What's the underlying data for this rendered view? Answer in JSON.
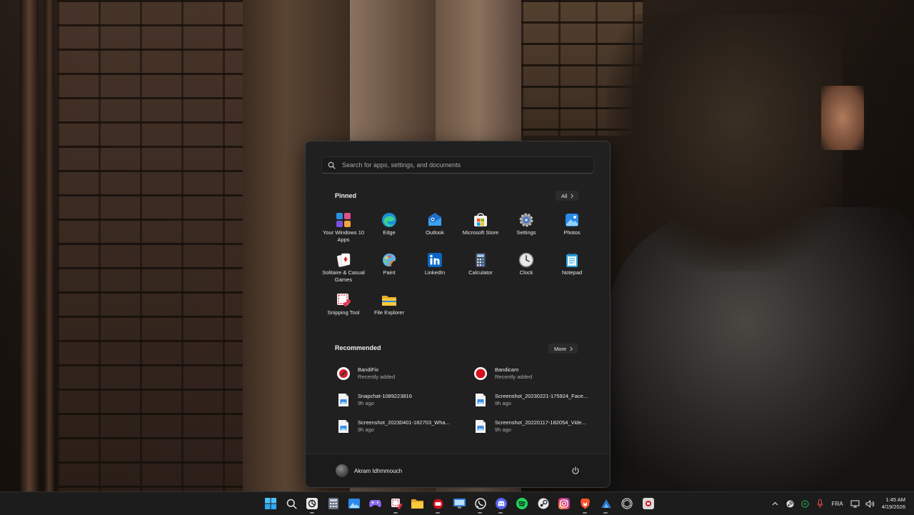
{
  "search": {
    "placeholder": "Search for apps, settings, and documents"
  },
  "pinned": {
    "title": "Pinned",
    "all_label": "All",
    "apps": [
      {
        "label": "Your Windows 10 Apps",
        "icon": "app-grid-icon"
      },
      {
        "label": "Edge",
        "icon": "edge-icon"
      },
      {
        "label": "Outlook",
        "icon": "outlook-icon"
      },
      {
        "label": "Microsoft Store",
        "icon": "store-icon"
      },
      {
        "label": "Settings",
        "icon": "gear-icon"
      },
      {
        "label": "Photos",
        "icon": "photos-icon"
      },
      {
        "label": "Solitaire & Casual Games",
        "icon": "cards-icon"
      },
      {
        "label": "Paint",
        "icon": "paint-icon"
      },
      {
        "label": "LinkedIn",
        "icon": "linkedin-icon"
      },
      {
        "label": "Calculator",
        "icon": "calculator-icon"
      },
      {
        "label": "Clock",
        "icon": "clock-icon"
      },
      {
        "label": "Notepad",
        "icon": "notepad-icon"
      },
      {
        "label": "Snipping Tool",
        "icon": "snipping-tool-icon"
      },
      {
        "label": "File Explorer",
        "icon": "folder-icon"
      }
    ]
  },
  "recommended": {
    "title": "Recommended",
    "more_label": "More",
    "items": [
      {
        "title": "BandiFix",
        "subtitle": "Recently added",
        "icon": "bandifix-icon"
      },
      {
        "title": "Bandicam",
        "subtitle": "Recently added",
        "icon": "bandicam-icon"
      },
      {
        "title": "Snapchat-1089223816",
        "subtitle": "9h ago",
        "icon": "image-file-icon"
      },
      {
        "title": "Screenshot_20230221-175924_Face...",
        "subtitle": "9h ago",
        "icon": "image-file-icon"
      },
      {
        "title": "Screenshot_20230401-182703_Wha...",
        "subtitle": "9h ago",
        "icon": "image-file-icon"
      },
      {
        "title": "Screenshot_20220117-182054_Vide...",
        "subtitle": "9h ago",
        "icon": "image-file-icon"
      }
    ]
  },
  "user": {
    "name": "Akram Idhmmouch"
  },
  "taskbar": {
    "icons": [
      "windows-start-icon",
      "search-icon",
      "chatgpt-icon",
      "calculator-icon",
      "photos-icon",
      "gamepad-icon",
      "snipping-tool-icon",
      "folder-icon",
      "bandicam-icon",
      "remote-desktop-icon",
      "whatsapp-icon",
      "discord-icon",
      "spotify-icon",
      "steam-icon",
      "instagram-icon",
      "brave-icon",
      "steam-icon",
      "unity-icon",
      "bandicut-icon"
    ]
  },
  "tray": {
    "language": "FRA",
    "time": "1:45 AM",
    "date": "4/19/2026"
  },
  "colors": {
    "accent": "#0078d4",
    "menu_bg": "#202020",
    "taskbar_bg": "#1c1c1c"
  }
}
